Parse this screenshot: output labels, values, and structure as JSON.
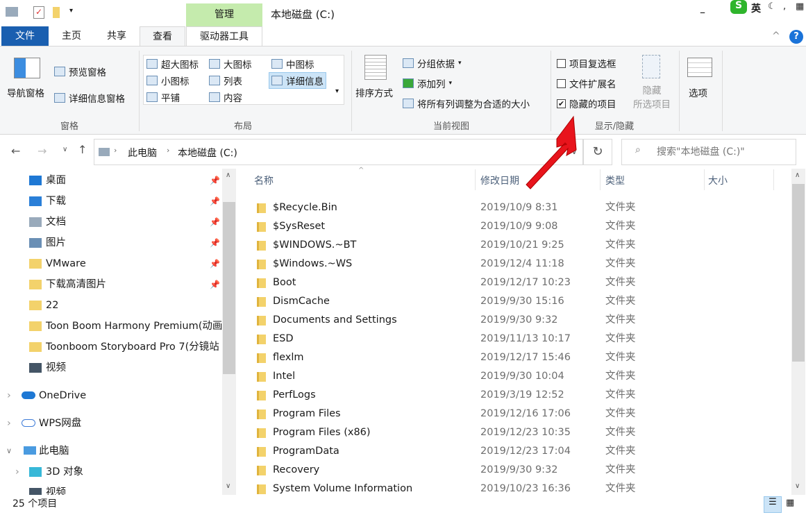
{
  "window": {
    "title": "本地磁盘 (C:)",
    "context_tab_group": "管理",
    "context_tab": "驱动器工具"
  },
  "tabs": [
    "文件",
    "主页",
    "共享",
    "查看"
  ],
  "ribbon": {
    "panes": {
      "nav_pane": "导航窗格",
      "preview_pane": "预览窗格",
      "details_pane": "详细信息窗格",
      "label": "窗格"
    },
    "layout": {
      "items": [
        "超大图标",
        "大图标",
        "中图标",
        "小图标",
        "列表",
        "详细信息",
        "平铺",
        "内容"
      ],
      "selected": "详细信息",
      "label": "布局"
    },
    "current_view": {
      "sort_by": "排序方式",
      "group_by": "分组依据",
      "add_columns": "添加列",
      "size_all_columns": "将所有列调整为合适的大小",
      "label": "当前视图"
    },
    "show_hide": {
      "item_checkboxes": {
        "label": "项目复选框",
        "checked": false
      },
      "file_extensions": {
        "label": "文件扩展名",
        "checked": false
      },
      "hidden_items": {
        "label": "隐藏的项目",
        "checked": true
      },
      "hide_selected_1": "隐藏",
      "hide_selected_2": "所选项目",
      "label": "显示/隐藏"
    },
    "options": "选项"
  },
  "address": {
    "crumbs": [
      "此电脑",
      "本地磁盘 (C:)"
    ],
    "search_placeholder": "搜索\"本地磁盘 (C:)\""
  },
  "ime": {
    "lang": "英"
  },
  "nav": {
    "quick_access": [
      {
        "label": "桌面",
        "pinned": true
      },
      {
        "label": "下载",
        "pinned": true
      },
      {
        "label": "文档",
        "pinned": true
      },
      {
        "label": "图片",
        "pinned": true
      },
      {
        "label": "VMware",
        "pinned": true
      },
      {
        "label": "下载高清图片",
        "pinned": true
      },
      {
        "label": "22"
      },
      {
        "label": "Toon Boom Harmony Premium(动画"
      },
      {
        "label": "Toonboom Storyboard Pro 7(分镜站"
      },
      {
        "label": "视频"
      }
    ],
    "onedrive": "OneDrive",
    "wps": "WPS网盘",
    "this_pc": "此电脑",
    "objects3d": "3D 对象",
    "videos": "视频"
  },
  "columns": {
    "name": "名称",
    "date": "修改日期",
    "type": "类型",
    "size": "大小"
  },
  "files": [
    {
      "name": "$Recycle.Bin",
      "date": "2019/10/9 8:31",
      "type": "文件夹"
    },
    {
      "name": "$SysReset",
      "date": "2019/10/9 9:08",
      "type": "文件夹"
    },
    {
      "name": "$WINDOWS.~BT",
      "date": "2019/10/21 9:25",
      "type": "文件夹"
    },
    {
      "name": "$Windows.~WS",
      "date": "2019/12/4 11:18",
      "type": "文件夹"
    },
    {
      "name": "Boot",
      "date": "2019/12/17 10:23",
      "type": "文件夹"
    },
    {
      "name": "DismCache",
      "date": "2019/9/30 15:16",
      "type": "文件夹"
    },
    {
      "name": "Documents and Settings",
      "date": "2019/9/30 9:32",
      "type": "文件夹"
    },
    {
      "name": "ESD",
      "date": "2019/11/13 10:17",
      "type": "文件夹"
    },
    {
      "name": "flexlm",
      "date": "2019/12/17 15:46",
      "type": "文件夹"
    },
    {
      "name": "Intel",
      "date": "2019/9/30 10:04",
      "type": "文件夹"
    },
    {
      "name": "PerfLogs",
      "date": "2019/3/19 12:52",
      "type": "文件夹"
    },
    {
      "name": "Program Files",
      "date": "2019/12/16 17:06",
      "type": "文件夹"
    },
    {
      "name": "Program Files (x86)",
      "date": "2019/12/23 10:35",
      "type": "文件夹"
    },
    {
      "name": "ProgramData",
      "date": "2019/12/23 17:04",
      "type": "文件夹"
    },
    {
      "name": "Recovery",
      "date": "2019/9/30 9:32",
      "type": "文件夹"
    },
    {
      "name": "System Volume Information",
      "date": "2019/10/23 16:36",
      "type": "文件夹"
    }
  ],
  "status": {
    "count": "25 个项目"
  },
  "colors": {
    "accent": "#1a5fb0",
    "context": "#c5ebad",
    "arrow": "#e8141c"
  }
}
